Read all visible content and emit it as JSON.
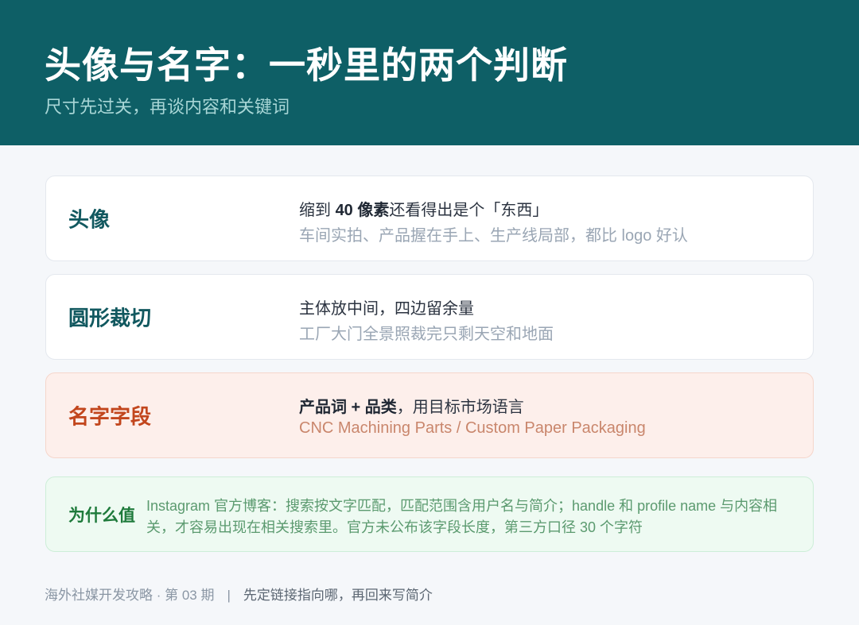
{
  "header": {
    "title": "头像与名字：一秒里的两个判断",
    "subtitle": "尺寸先过关，再谈内容和关键词"
  },
  "cards": [
    {
      "label": "头像",
      "line1_pre": "缩到 ",
      "line1_bold": "40 像素",
      "line1_post": "还看得出是个「东西」",
      "line2": "车间实拍、产品握在手上、生产线局部，都比 logo 好认"
    },
    {
      "label": "圆形裁切",
      "line1_pre": "主体放中间，四边留余量",
      "line1_bold": "",
      "line1_post": "",
      "line2": "工厂大门全景照裁完只剩天空和地面"
    },
    {
      "label": "名字字段",
      "line1_pre": "",
      "line1_bold": "产品词 + 品类",
      "line1_post": "，用目标市场语言",
      "line2": "CNC Machining Parts / Custom Paper Packaging"
    }
  ],
  "why": {
    "label": "为什么值",
    "text": "Instagram 官方博客：搜索按文字匹配，匹配范围含用户名与简介；handle 和 profile name 与内容相关，才容易出现在相关搜索里。官方未公布该字段长度，第三方口径 30 个字符"
  },
  "footer": {
    "series": "海外社媒开发攻略 · 第 03 期",
    "separator": "|",
    "tagline": "先定链接指向哪，再回来写简介"
  },
  "colors": {
    "header_bg": "#0e5f66",
    "accent_teal": "#11585f",
    "accent_orange": "#c2461d",
    "accent_green": "#1e7a3b"
  }
}
